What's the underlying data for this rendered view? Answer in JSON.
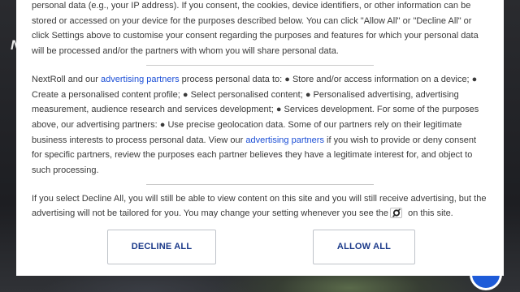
{
  "background": {
    "letter": "N"
  },
  "consent": {
    "para1": "personal data (e.g., your IP address). If you consent, the cookies, device identifiers, or other information can be stored or accessed on your device for the purposes described below. You can click \"Allow All\" or \"Decline All\" or click Settings above to customise your consent regarding the purposes and features for which your personal data will be processed and/or the partners with whom you will share personal data.",
    "para2_a": "NextRoll and our ",
    "para2_link1": "advertising partners",
    "para2_b": " process personal data to: ● Store and/or access information on a device; ● Create a personalised content profile; ● Select personalised content; ● Personalised advertising, advertising measurement, audience research and services development; ● Services development. For some of the purposes above, our advertising partners: ● Use precise geolocation data. Some of our partners rely on their legitimate business interests to process personal data. View our ",
    "para2_link2": "advertising partners",
    "para2_c": " if you wish to provide or deny consent for specific partners, review the purposes each partner believes they have a legitimate interest for, and object to such processing.",
    "para3_a": "If you select Decline All, you will still be able to view content on this site and you will still receive advertising, but the advertising will not be tailored for you. You may change your setting whenever you see the",
    "para3_b": " on this site.",
    "settings_icon": "settings-cog-icon",
    "decline_label": "DECLINE ALL",
    "allow_label": "ALLOW ALL"
  },
  "colors": {
    "link": "#1c4fd6",
    "button_text": "#1b3a8a",
    "fab": "#1e5bd8"
  }
}
